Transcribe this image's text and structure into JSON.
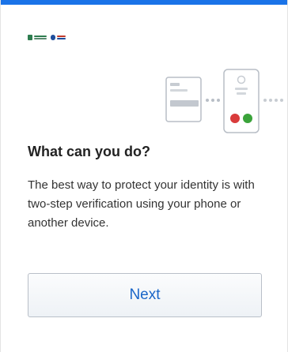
{
  "screen": {
    "title": "What can you do?",
    "description": "The best way to protect your identity is with two-step verification using your phone or another device.",
    "next_label": "Next"
  },
  "icons": {
    "illustration": "two-step-verification-devices-illustration",
    "logo": "organization-logos"
  },
  "colors": {
    "accent": "#1a73e8",
    "button_text": "#1a66c8",
    "deny_dot": "#d93b3b",
    "approve_dot": "#3aa33a"
  }
}
